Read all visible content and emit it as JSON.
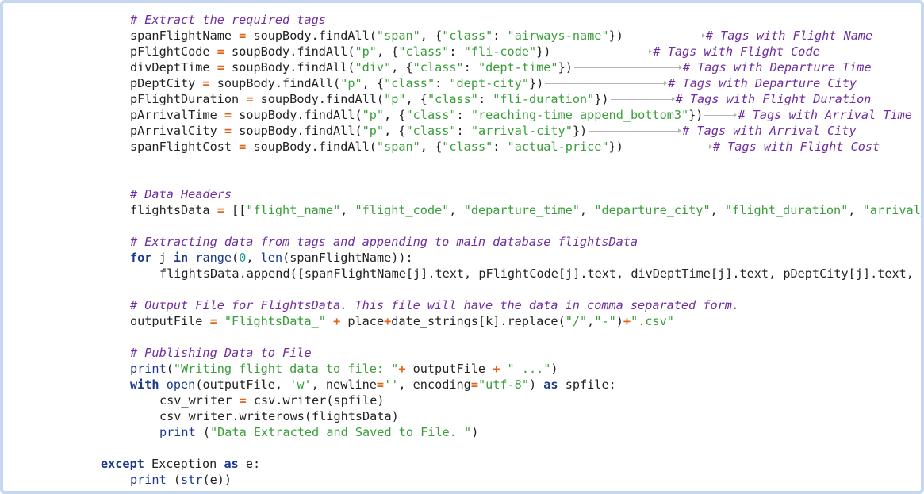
{
  "code": {
    "comment_extract": "# Extract the required tags",
    "l1": {
      "var": "spanFlightName",
      "pre": " soupBody.findAll(",
      "tag": "\"span\"",
      "mid1": ", {",
      "key": "\"class\"",
      "mid2": ": ",
      "cls": "\"airways-name\"",
      "post": "})",
      "cmt": "# Tags with Flight Name"
    },
    "l2": {
      "var": "pFlightCode",
      "pre": " soupBody.findAll(",
      "tag": "\"p\"",
      "mid1": ", {",
      "key": "\"class\"",
      "mid2": ": ",
      "cls": "\"fli-code\"",
      "post": "})",
      "cmt": "# Tags with Flight Code"
    },
    "l3": {
      "var": "divDeptTime",
      "pre": " soupBody.findAll(",
      "tag": "\"div\"",
      "mid1": ", {",
      "key": "\"class\"",
      "mid2": ": ",
      "cls": "\"dept-time\"",
      "post": "})",
      "cmt": "# Tags with Departure Time"
    },
    "l4": {
      "var": "pDeptCity",
      "pre": " soupBody.findAll(",
      "tag": "\"p\"",
      "mid1": ", {",
      "key": "\"class\"",
      "mid2": ": ",
      "cls": "\"dept-city\"",
      "post": "})",
      "cmt": "# Tags with Departure City"
    },
    "l5": {
      "var": "pFlightDuration",
      "pre": " soupBody.findAll(",
      "tag": "\"p\"",
      "mid1": ", {",
      "key": "\"class\"",
      "mid2": ": ",
      "cls": "\"fli-duration\"",
      "post": "})",
      "cmt": "# Tags with Flight Duration"
    },
    "l6": {
      "var": "pArrivalTime",
      "pre": " soupBody.findAll(",
      "tag": "\"p\"",
      "mid1": ", {",
      "key": "\"class\"",
      "mid2": ": ",
      "cls": "\"reaching-time append_bottom3\"",
      "post": "})",
      "cmt": "# Tags with Arrival Time"
    },
    "l7": {
      "var": "pArrivalCity",
      "pre": " soupBody.findAll(",
      "tag": "\"p\"",
      "mid1": ", {",
      "key": "\"class\"",
      "mid2": ": ",
      "cls": "\"arrival-city\"",
      "post": "})",
      "cmt": "# Tags with Arrival City"
    },
    "l8": {
      "var": "spanFlightCost",
      "pre": " soupBody.findAll(",
      "tag": "\"span\"",
      "mid1": ", {",
      "key": "\"class\"",
      "mid2": ": ",
      "cls": "\"actual-price\"",
      "post": "})",
      "cmt": "# Tags with Flight Cost"
    },
    "comment_headers": "# Data Headers",
    "fd": {
      "var": "flightsData",
      "pre": " [[",
      "s1": "\"flight_name\"",
      "s2": "\"flight_code\"",
      "s3": "\"departure_time\"",
      "s4": "\"departure_city\"",
      "s5": "\"flight_duration\"",
      "s6": "\"arrival_time\"",
      "sep": ", "
    },
    "comment_append": "# Extracting data from tags and appending to main database flightsData",
    "for": {
      "kw_for": "for",
      "var": " j ",
      "kw_in": "in",
      "range": "range",
      "open": "(",
      "zero": "0",
      "mid": ", ",
      "len": "len",
      "post": "(spanFlightName)):"
    },
    "append_line": "flightsData.append([spanFlightName[j].text, pFlightCode[j].text, divDeptTime[j].text, pDeptCity[j].text, pFlightDuration[j].text, pArrivalTime[j].text, pArrivalCity[j].text, spanFlightCost[j].text])",
    "comment_output": "# Output File for FlightsData. This file will have the data in comma separated form.",
    "out": {
      "var": "outputFile",
      "s1": "\"FlightsData_\"",
      "mid1": " place",
      "mid2": "date_strings[k].replace(",
      "s2": "\"/\"",
      "comma": ",",
      "s3": "\"-\"",
      "close": ")",
      "s4": "\".csv\""
    },
    "comment_publish": "# Publishing Data to File",
    "print1": {
      "fn": "print",
      "open": "(",
      "s1": "\"Writing flight data to file: \"",
      "var": " outputFile ",
      "s2": "\" ...\"",
      "close": ")"
    },
    "with": {
      "kw": "with",
      "fn": "open",
      "pre": "(outputFile, ",
      "s1": "'w'",
      "mid": ", newline",
      "s2": "''",
      "mid2": ", encoding",
      "s3": "\"utf-8\"",
      "post": ") ",
      "kw_as": "as",
      "tail": " spfile:"
    },
    "csvw": {
      "var": "csv_writer",
      "tail": " csv.writer(spfile)"
    },
    "writerows": "csv_writer.writerows(flightsData)",
    "print2": {
      "fn": "print",
      "open": " (",
      "s1": "\"Data Extracted and Saved to File. \"",
      "close": ")"
    },
    "except": {
      "kw": "except",
      "mid": " Exception ",
      "kw_as": "as",
      "tail": " e:"
    },
    "print3": {
      "fn": "print",
      "open": " (",
      "str": "str",
      "tail": "(e))"
    },
    "op_eq": "=",
    "op_plus": "+"
  }
}
